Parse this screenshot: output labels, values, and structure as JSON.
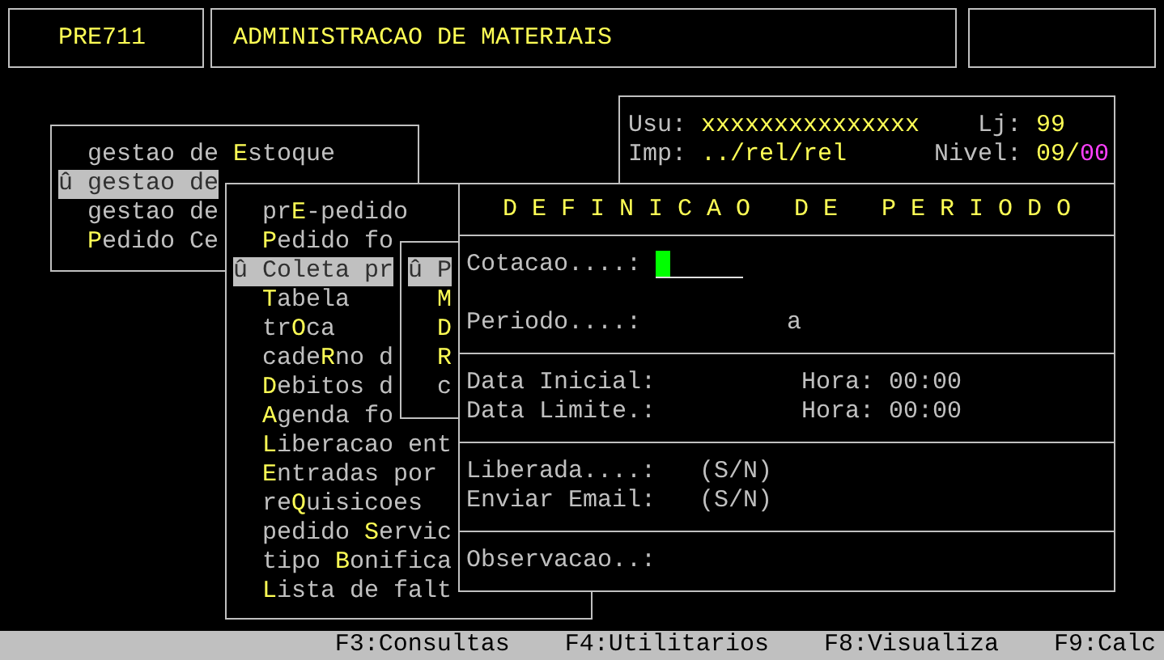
{
  "header": {
    "code": "PRE711",
    "title": "ADMINISTRACAO DE MATERIAIS"
  },
  "session": {
    "user_label": "Usu:",
    "user": "xxxxxxxxxxxxxxx",
    "store_label": "Lj:",
    "store": "99",
    "printer_label": "Imp:",
    "printer": "../rel/rel",
    "level_label": "Nivel:",
    "level_main": "09/",
    "level_sub": "00"
  },
  "menus": [
    {
      "items": [
        {
          "text": "gestao de **E**stoque",
          "selected": false
        },
        {
          "text": "û gestao de",
          "selected": true
        },
        {
          "text": "gestao de",
          "selected": false
        },
        {
          "text": "**P**edido Ce",
          "selected": false
        }
      ]
    },
    {
      "items": [
        {
          "text": "pr**E**-pedido",
          "selected": false
        },
        {
          "text": "**P**edido fo",
          "selected": false
        },
        {
          "text": "û Coleta pr",
          "selected": true
        },
        {
          "text": "**T**abela",
          "selected": false
        },
        {
          "text": "tr**O**ca",
          "selected": false
        },
        {
          "text": "cade**R**no d",
          "selected": false
        },
        {
          "text": "**D**ebitos d",
          "selected": false
        },
        {
          "text": "**A**genda fo",
          "selected": false
        },
        {
          "text": "**L**iberacao ent",
          "selected": false
        },
        {
          "text": "**E**ntradas por",
          "selected": false
        },
        {
          "text": "re**Q**uisicoes",
          "selected": false
        },
        {
          "text": "pedido **S**ervic",
          "selected": false
        },
        {
          "text": "tipo **B**onifica",
          "selected": false
        },
        {
          "text": "**L**ista de falt",
          "selected": false
        }
      ]
    },
    {
      "items": [
        {
          "text": "û P",
          "selected": true
        },
        {
          "text": "**M**",
          "selected": false
        },
        {
          "text": "**D**",
          "selected": false
        },
        {
          "text": "**R**",
          "selected": false
        },
        {
          "text": "c",
          "selected": false
        }
      ]
    }
  ],
  "dialog": {
    "title": "D E F I N I C A O   D E   P E R I O D O",
    "sections": [
      {
        "rows": [
          {
            "kind": "field",
            "label": "Cotacao....:"
          },
          {
            "kind": "range",
            "label": "Periodo....:",
            "middle": "a"
          }
        ]
      },
      {
        "rows": [
          {
            "kind": "time",
            "label": "Data Inicial:",
            "time_label": "Hora:",
            "time": "00:00"
          },
          {
            "kind": "time",
            "label": "Data Limite.:",
            "time_label": "Hora:",
            "time": "00:00"
          }
        ]
      },
      {
        "rows": [
          {
            "kind": "flag",
            "label": "Liberada....:",
            "hint": "(S/N)"
          },
          {
            "kind": "flag",
            "label": "Enviar Email:",
            "hint": "(S/N)"
          }
        ]
      },
      {
        "rows": [
          {
            "kind": "text",
            "label": "Observacao..:"
          }
        ]
      }
    ]
  },
  "status_bar": [
    "F3:Consultas",
    "F4:Utilitarios",
    "F8:Visualiza",
    "F9:Calc"
  ]
}
